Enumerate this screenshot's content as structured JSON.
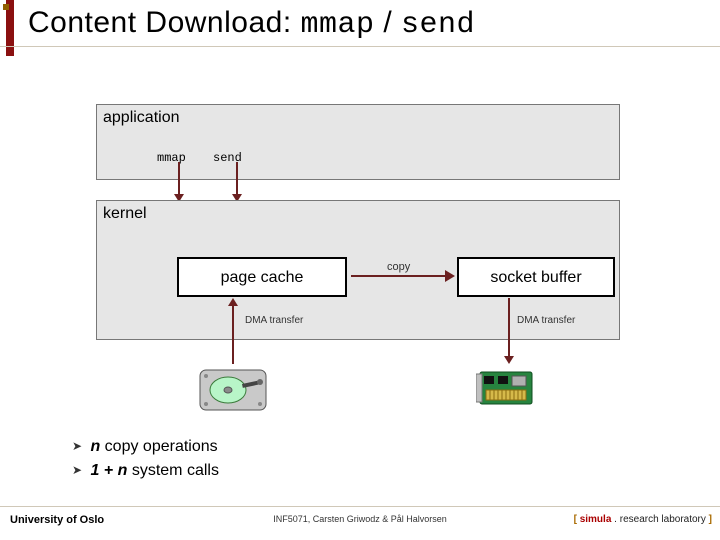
{
  "title": {
    "prefix": "Content Download: ",
    "code1": "mmap",
    "sep": " / ",
    "code2": "send"
  },
  "app": {
    "label": "application",
    "syscall1": "mmap",
    "syscall2": "send"
  },
  "kernel": {
    "label": "kernel",
    "page_cache": "page cache",
    "socket_buffer": "socket buffer",
    "copy_label": "copy",
    "dma_left": "DMA transfer",
    "dma_right": "DMA transfer"
  },
  "bullets": {
    "line1_var": "n",
    "line1_rest": " copy operations",
    "line2_pre": "1 + ",
    "line2_var": "n",
    "line2_rest": "  system calls"
  },
  "footer": {
    "uoo": "University of Oslo",
    "course": "INF5071, Carsten Griwodz & Pål Halvorsen",
    "simula_open": "[ ",
    "simula_name": "simula",
    "simula_dot": " . ",
    "simula_rest": "research laboratory",
    "simula_close": " ]"
  }
}
